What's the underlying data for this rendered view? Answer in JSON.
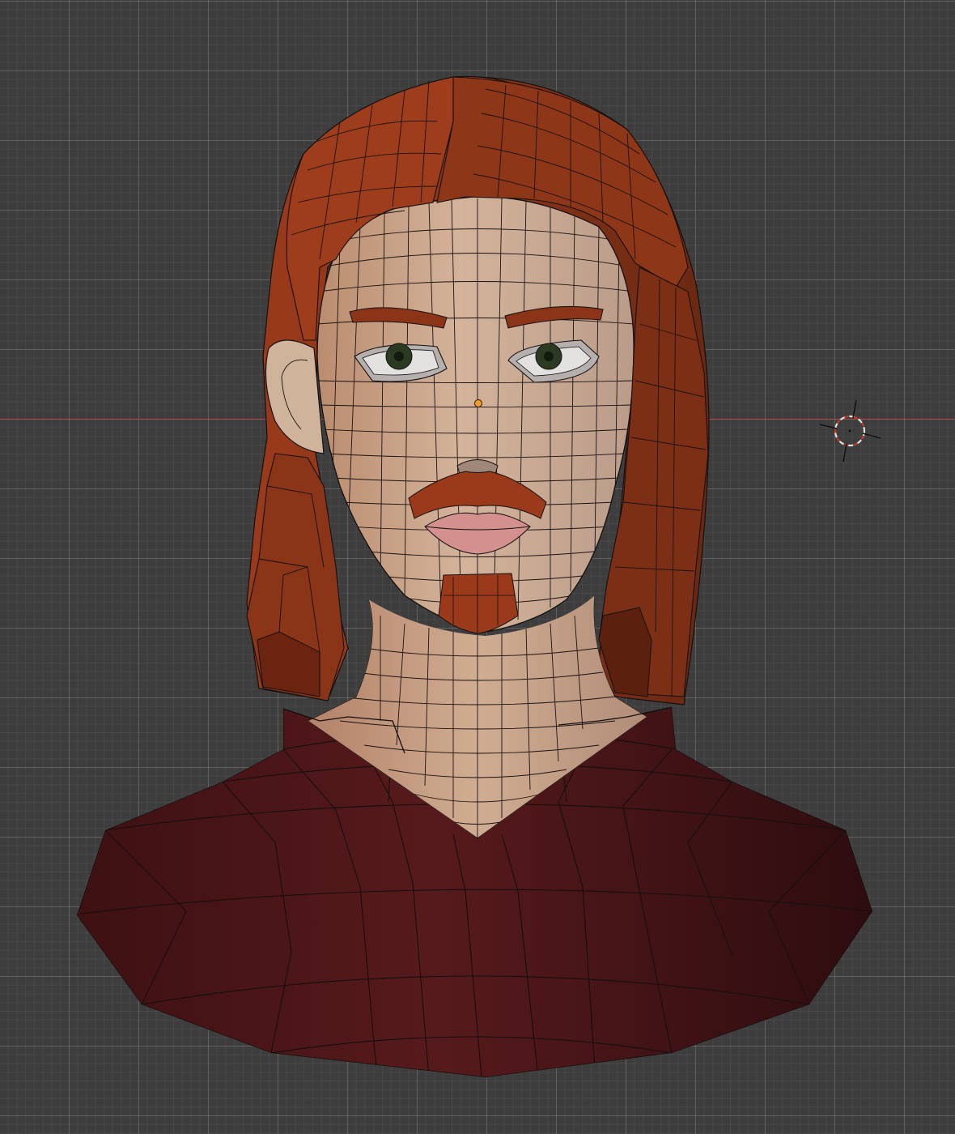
{
  "viewport": {
    "background_color": "#3d3d3d",
    "grid_color": "#4a4a4a",
    "x_axis_color": "#b24a50"
  },
  "model": {
    "skin_color": "#c8a48a",
    "hair_color": "#8a3518",
    "shirt_color": "#4a1518",
    "lip_color": "#d3908c",
    "eye_color": "#2c3a22",
    "wire_color": "#141010"
  },
  "origin_color": "#f29c2a",
  "icons": [
    "3d-cursor-icon",
    "origin-point-icon"
  ]
}
